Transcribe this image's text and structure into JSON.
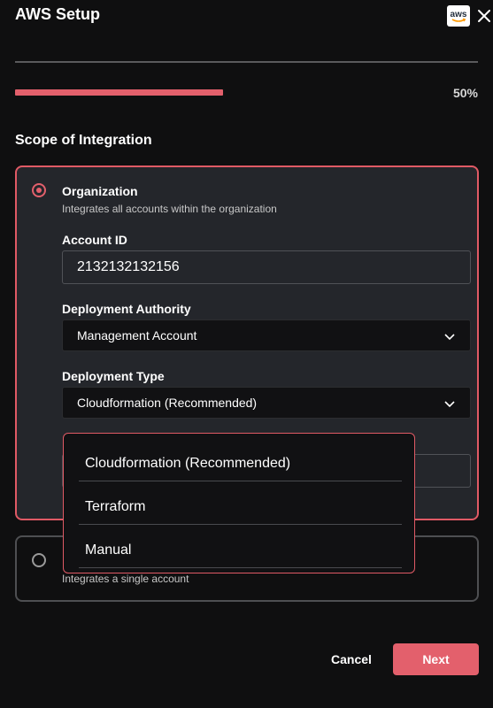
{
  "header": {
    "title": "AWS Setup",
    "logo_text": "aws",
    "close_icon": "close-icon"
  },
  "progress": {
    "percent": 50,
    "label": "50%",
    "color": "#e3606c"
  },
  "section": {
    "heading": "Scope of Integration"
  },
  "options": {
    "organization": {
      "title": "Organization",
      "description": "Integrates all accounts within the organization",
      "selected": true
    },
    "single_account": {
      "description": "Integrates a single account",
      "selected": false
    }
  },
  "form": {
    "account_id": {
      "label": "Account ID",
      "value": "2132132132156"
    },
    "deployment_authority": {
      "label": "Deployment Authority",
      "value": "Management Account"
    },
    "deployment_type": {
      "label": "Deployment Type",
      "value": "Cloudformation (Recommended)"
    }
  },
  "dropdown": {
    "items": [
      {
        "label": "Cloudformation (Recommended)"
      },
      {
        "label": "Terraform"
      },
      {
        "label": "Manual"
      }
    ]
  },
  "footer": {
    "cancel_label": "Cancel",
    "next_label": "Next"
  },
  "colors": {
    "accent": "#e3606c",
    "background": "#0f0f10",
    "card": "#24262b"
  }
}
